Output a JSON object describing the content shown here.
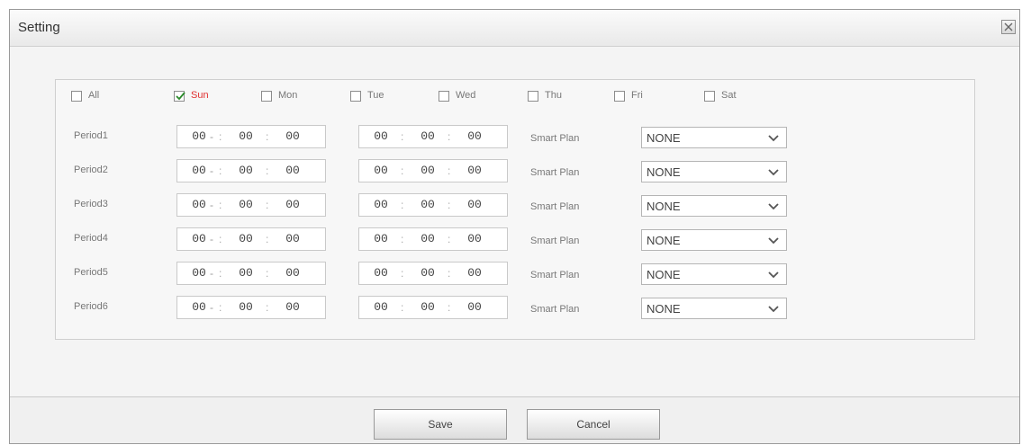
{
  "dialog": {
    "title": "Setting"
  },
  "days": [
    {
      "label": "All",
      "checked": false
    },
    {
      "label": "Sun",
      "checked": true
    },
    {
      "label": "Mon",
      "checked": false
    },
    {
      "label": "Tue",
      "checked": false
    },
    {
      "label": "Wed",
      "checked": false
    },
    {
      "label": "Thu",
      "checked": false
    },
    {
      "label": "Fri",
      "checked": false
    },
    {
      "label": "Sat",
      "checked": false
    }
  ],
  "periods": [
    {
      "label": "Period1",
      "start": [
        "00",
        "00",
        "00"
      ],
      "end": [
        "00",
        "00",
        "00"
      ],
      "smart_plan_label": "Smart Plan",
      "smart_plan_value": "NONE"
    },
    {
      "label": "Period2",
      "start": [
        "00",
        "00",
        "00"
      ],
      "end": [
        "00",
        "00",
        "00"
      ],
      "smart_plan_label": "Smart Plan",
      "smart_plan_value": "NONE"
    },
    {
      "label": "Period3",
      "start": [
        "00",
        "00",
        "00"
      ],
      "end": [
        "00",
        "00",
        "00"
      ],
      "smart_plan_label": "Smart Plan",
      "smart_plan_value": "NONE"
    },
    {
      "label": "Period4",
      "start": [
        "00",
        "00",
        "00"
      ],
      "end": [
        "00",
        "00",
        "00"
      ],
      "smart_plan_label": "Smart Plan",
      "smart_plan_value": "NONE"
    },
    {
      "label": "Period5",
      "start": [
        "00",
        "00",
        "00"
      ],
      "end": [
        "00",
        "00",
        "00"
      ],
      "smart_plan_label": "Smart Plan",
      "smart_plan_value": "NONE"
    },
    {
      "label": "Period6",
      "start": [
        "00",
        "00",
        "00"
      ],
      "end": [
        "00",
        "00",
        "00"
      ],
      "smart_plan_label": "Smart Plan",
      "smart_plan_value": "NONE"
    }
  ],
  "time_separator": ":",
  "range_separator": "-",
  "buttons": {
    "save": "Save",
    "cancel": "Cancel"
  },
  "icons": {
    "close": "close-icon",
    "checkmark": "checkmark-icon",
    "dropdown": "chevron-down-icon"
  },
  "colors": {
    "checked_day_label": "#e03030"
  }
}
